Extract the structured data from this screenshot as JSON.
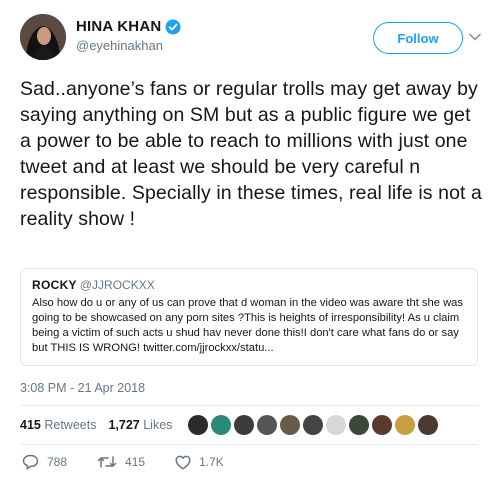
{
  "user": {
    "display_name": "HINA KHAN",
    "handle": "@eyehinakhan",
    "follow_label": "Follow",
    "brand_color": "#1da1f2"
  },
  "tweet": {
    "text": "Sad..anyone’s fans or regular trolls may get away by saying anything on SM but as a public figure we get a power to be able to reach to millions with just one tweet and at least we should be very careful n responsible. Specially in these times, real life is not a reality show !",
    "timestamp": "3:08 PM - 21 Apr 2018"
  },
  "quote": {
    "author_name": "ROCKY",
    "author_handle": "@JJROCKXX",
    "text": "Also how do u or any of us can prove that d woman in the video was aware tht she was going to be showcased on any porn sites ?This is heights of irresponsibility! As u claim being a victim of such acts u shud hav never done this!I don't care what fans do or say but THIS IS WRONG! twitter.com/jjrockxx/statu..."
  },
  "stats": {
    "retweets_count": "415",
    "retweets_label": "Retweets",
    "likes_count": "1,727",
    "likes_label": "Likes",
    "liker_avatar_colors": [
      "#2b2b2b",
      "#2a8a7a",
      "#3c3c3c",
      "#555555",
      "#6a5a4a",
      "#444444",
      "#d8d8d8",
      "#3a4a3a",
      "#5a3a2a",
      "#c8a040",
      "#4a3a30"
    ]
  },
  "actions": {
    "replies": "788",
    "retweets": "415",
    "likes": "1.7K"
  }
}
